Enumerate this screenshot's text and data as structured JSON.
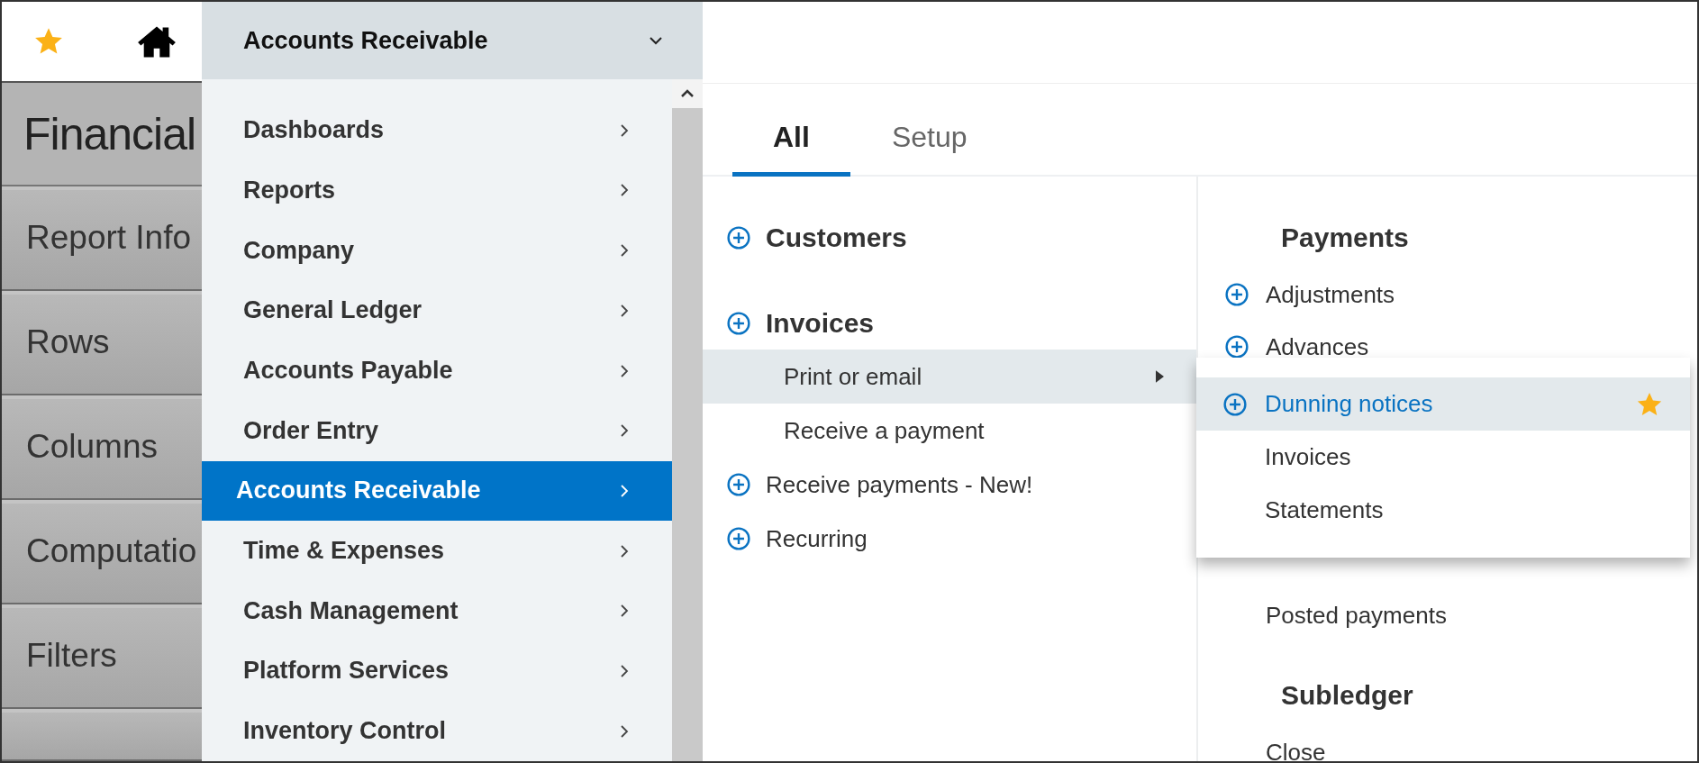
{
  "header": {
    "menu_title": "Accounts Receivable"
  },
  "side_panel": {
    "items": [
      {
        "label": "Financial",
        "kind": "title"
      },
      {
        "label": "Report Info",
        "kind": "tab"
      },
      {
        "label": "Rows",
        "kind": "tab"
      },
      {
        "label": "Columns",
        "kind": "tab"
      },
      {
        "label": "Computatio",
        "kind": "tab"
      },
      {
        "label": "Filters",
        "kind": "tab"
      }
    ]
  },
  "module_menu": {
    "items": [
      {
        "label": "Dashboards",
        "selected": false
      },
      {
        "label": "Reports",
        "selected": false
      },
      {
        "label": "Company",
        "selected": false
      },
      {
        "label": "General Ledger",
        "selected": false
      },
      {
        "label": "Accounts Payable",
        "selected": false
      },
      {
        "label": "Order Entry",
        "selected": false
      },
      {
        "label": "Accounts Receivable",
        "selected": true
      },
      {
        "label": "Time & Expenses",
        "selected": false
      },
      {
        "label": "Cash Management",
        "selected": false
      },
      {
        "label": "Platform Services",
        "selected": false
      },
      {
        "label": "Inventory Control",
        "selected": false
      }
    ]
  },
  "tabs": [
    {
      "label": "All",
      "selected": true
    },
    {
      "label": "Setup",
      "selected": false
    }
  ],
  "left_column": {
    "sections": [
      {
        "title": "Customers",
        "addable": true
      },
      {
        "title": "Invoices",
        "addable": true,
        "items": [
          {
            "label": "Print or email",
            "addable": false,
            "selected": true,
            "has_submenu": true
          },
          {
            "label": "Receive a payment",
            "addable": false,
            "selected": false,
            "has_submenu": false
          },
          {
            "label": "Receive payments - New!",
            "addable": true,
            "selected": false,
            "has_submenu": false
          },
          {
            "label": "Recurring",
            "addable": true,
            "selected": false,
            "has_submenu": false
          }
        ]
      }
    ]
  },
  "right_column": {
    "sections": [
      {
        "title": "Payments",
        "items": [
          {
            "label": "Adjustments",
            "addable": true
          },
          {
            "label": "Advances",
            "addable": true
          },
          {
            "kind": "hidden"
          },
          {
            "label": "Posted payments",
            "addable": false
          }
        ]
      },
      {
        "title": "Subledger",
        "items": [
          {
            "label": "Close",
            "addable": false
          }
        ]
      }
    ]
  },
  "flyout": {
    "items": [
      {
        "label": "Dunning notices",
        "addable": true,
        "selected": true,
        "favorite": true
      },
      {
        "label": "Invoices",
        "addable": false,
        "selected": false,
        "favorite": false
      },
      {
        "label": "Statements",
        "addable": false,
        "selected": false,
        "favorite": false
      }
    ]
  }
}
